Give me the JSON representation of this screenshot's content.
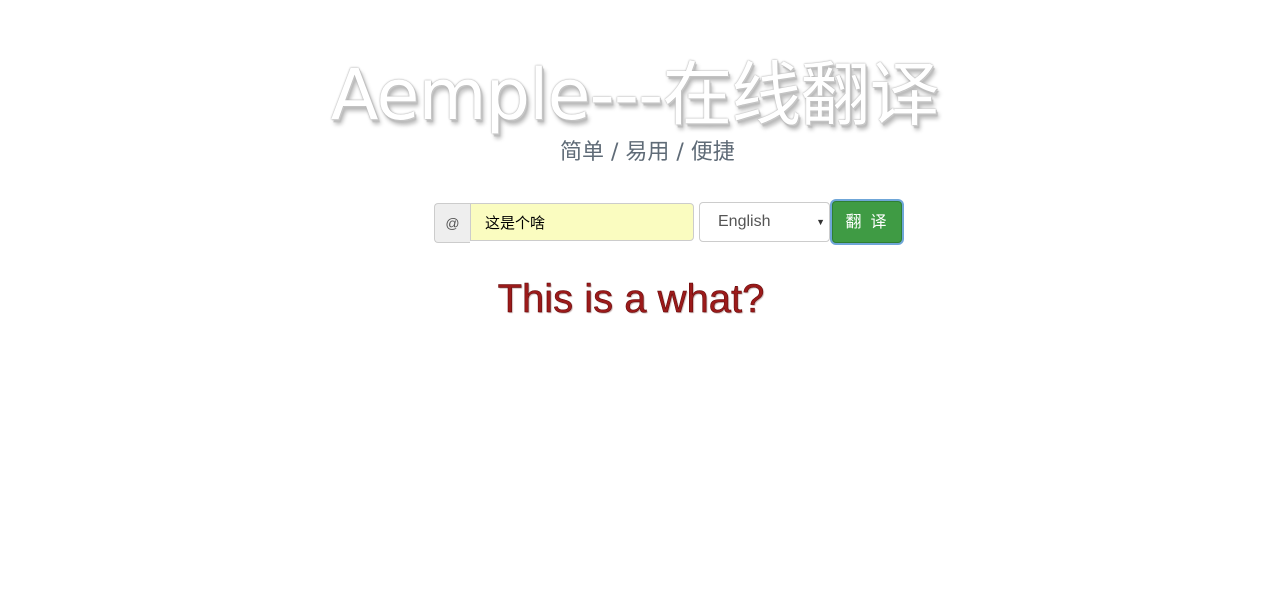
{
  "header": {
    "title": "Aemple---在线翻译",
    "subtitle": "简单 / 易用 / 便捷"
  },
  "form": {
    "addon_symbol": "@",
    "input_value": "这是个啥",
    "language_selected": "English",
    "submit_label": "翻 译"
  },
  "result": {
    "text": "This is a what?"
  },
  "colors": {
    "button": "#3f9b44",
    "input_background": "#fafcc0",
    "result_text": "#9b1a1a"
  }
}
